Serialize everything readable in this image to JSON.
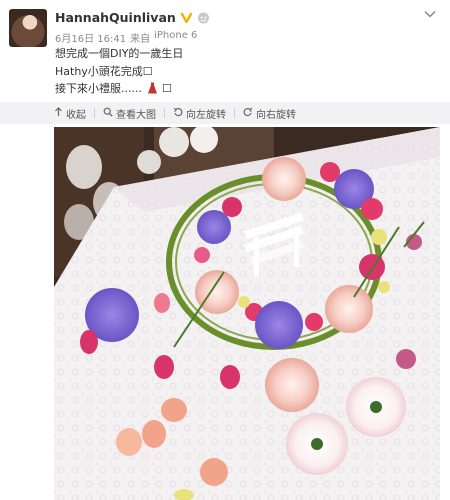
{
  "post": {
    "username": "HannahQuinlivan",
    "verified_icon": "verified-v-icon",
    "member_icon": "member-badge-icon",
    "timestamp": "6月16日 16:41",
    "source_prefix": "来自",
    "source": "iPhone 6",
    "text_lines": [
      "想完成一個DIY的一歲生日",
      "Hathy小頭花完成☐",
      "接下來小禮服......"
    ],
    "text_tail_box": "☐",
    "accent_color": "#eb7350",
    "verified_color": "#f3b200"
  },
  "toolbar": {
    "collapse": "收起",
    "view_large": "查看大图",
    "rotate_left": "向左旋转",
    "rotate_right": "向右旋转"
  }
}
